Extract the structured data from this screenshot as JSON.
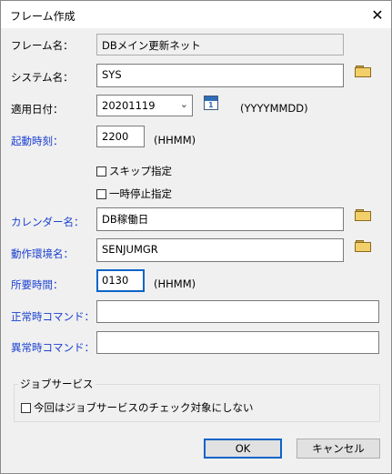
{
  "window": {
    "title": "フレーム作成",
    "close_glyph": "✕"
  },
  "fields": {
    "frame_name": {
      "label": "フレーム名：",
      "value": "DBメイン更新ネット"
    },
    "system_name": {
      "label": "システム名：",
      "value": "SYS"
    },
    "apply_date": {
      "label": "適用日付：",
      "value": "20201119",
      "format": "(YYYYMMDD)",
      "calendar_num": "1"
    },
    "start_time": {
      "label": "起動時刻：",
      "value": "2200",
      "format": "(HHMM)"
    },
    "skip": {
      "label": "スキップ指定"
    },
    "pause": {
      "label": "一時停止指定"
    },
    "calendar_name": {
      "label": "カレンダー名：",
      "value": "DB稼働日"
    },
    "env_name": {
      "label": "動作環境名：",
      "value": "SENJUMGR"
    },
    "required_time": {
      "label": "所要時間：",
      "value": "0130",
      "format": "(HHMM)"
    },
    "normal_cmd": {
      "label": "正常時コマンド：",
      "value": ""
    },
    "abnormal_cmd": {
      "label": "異常時コマンド：",
      "value": ""
    }
  },
  "job_service": {
    "group_title": "ジョブサービス",
    "no_check_label": "今回はジョブサービスのチェック対象にしない"
  },
  "buttons": {
    "ok": "OK",
    "cancel": "キャンセル"
  },
  "colors": {
    "label_blue": "#1a3fd0",
    "focus_border": "#0a64c8"
  },
  "icons": {
    "folder": "folder-icon",
    "calendar": "calendar-icon",
    "dropdown": "chevron-down-icon"
  }
}
